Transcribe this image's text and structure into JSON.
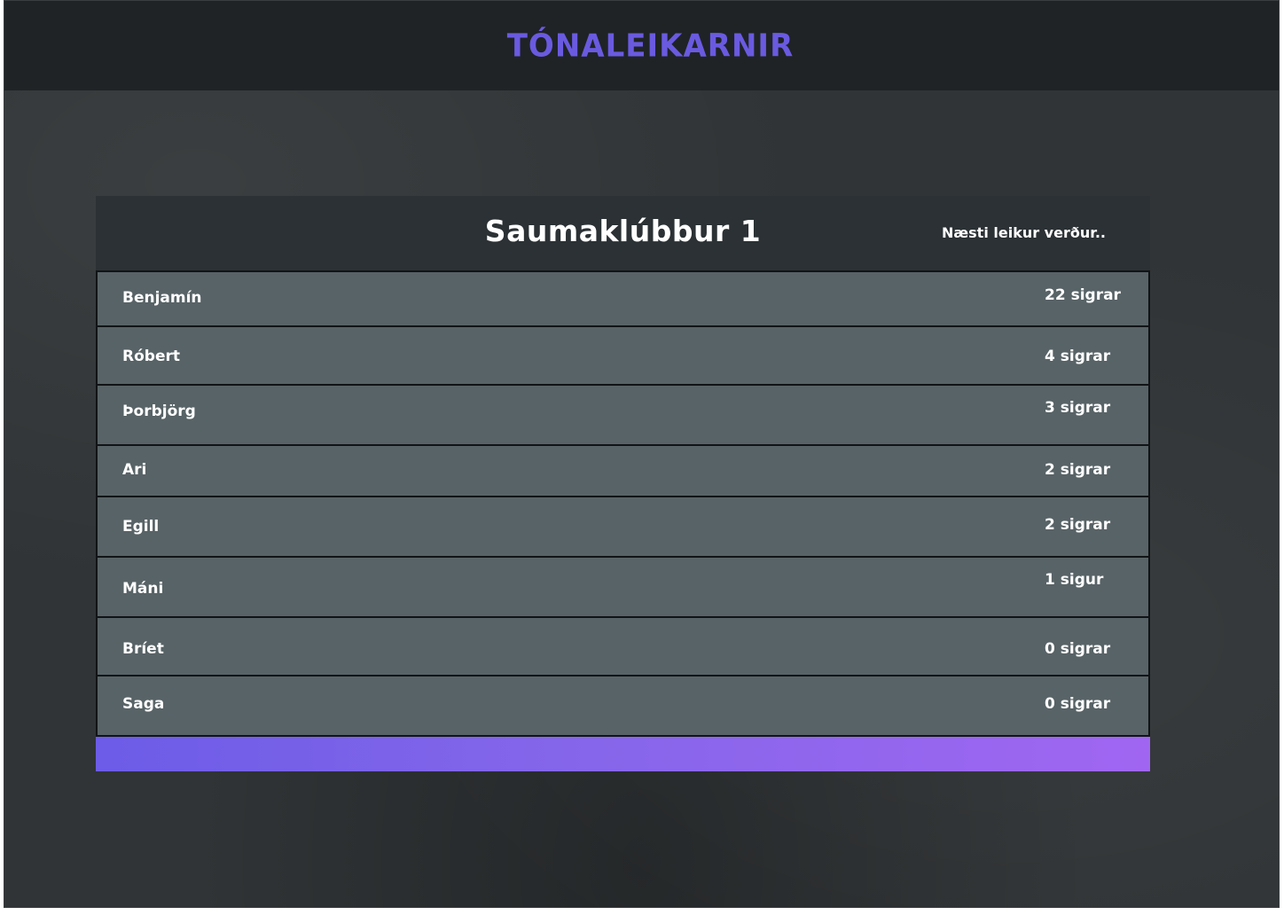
{
  "header": {
    "title": "TÓNALEIKARNIR"
  },
  "board": {
    "title": "Saumaklúbbur 1",
    "next_game_label": "Næsti leikur verður..",
    "players": [
      {
        "name": "Benjamín",
        "wins": "22 sigrar"
      },
      {
        "name": "Róbert",
        "wins": "4 sigrar"
      },
      {
        "name": "Þorbjörg",
        "wins": "3 sigrar"
      },
      {
        "name": "Ari",
        "wins": "2 sigrar"
      },
      {
        "name": "Egill",
        "wins": "2 sigrar"
      },
      {
        "name": "Máni",
        "wins": "1 sigur"
      },
      {
        "name": "Bríet",
        "wins": "0 sigrar"
      },
      {
        "name": "Saga",
        "wins": "0 sigrar"
      }
    ]
  },
  "colors": {
    "accent": "#6a5ae0",
    "header_bg": "#1f2326",
    "row_bg": "#586367",
    "footer_gradient_start": "#6c5ce7",
    "footer_gradient_end": "#a066f2"
  }
}
